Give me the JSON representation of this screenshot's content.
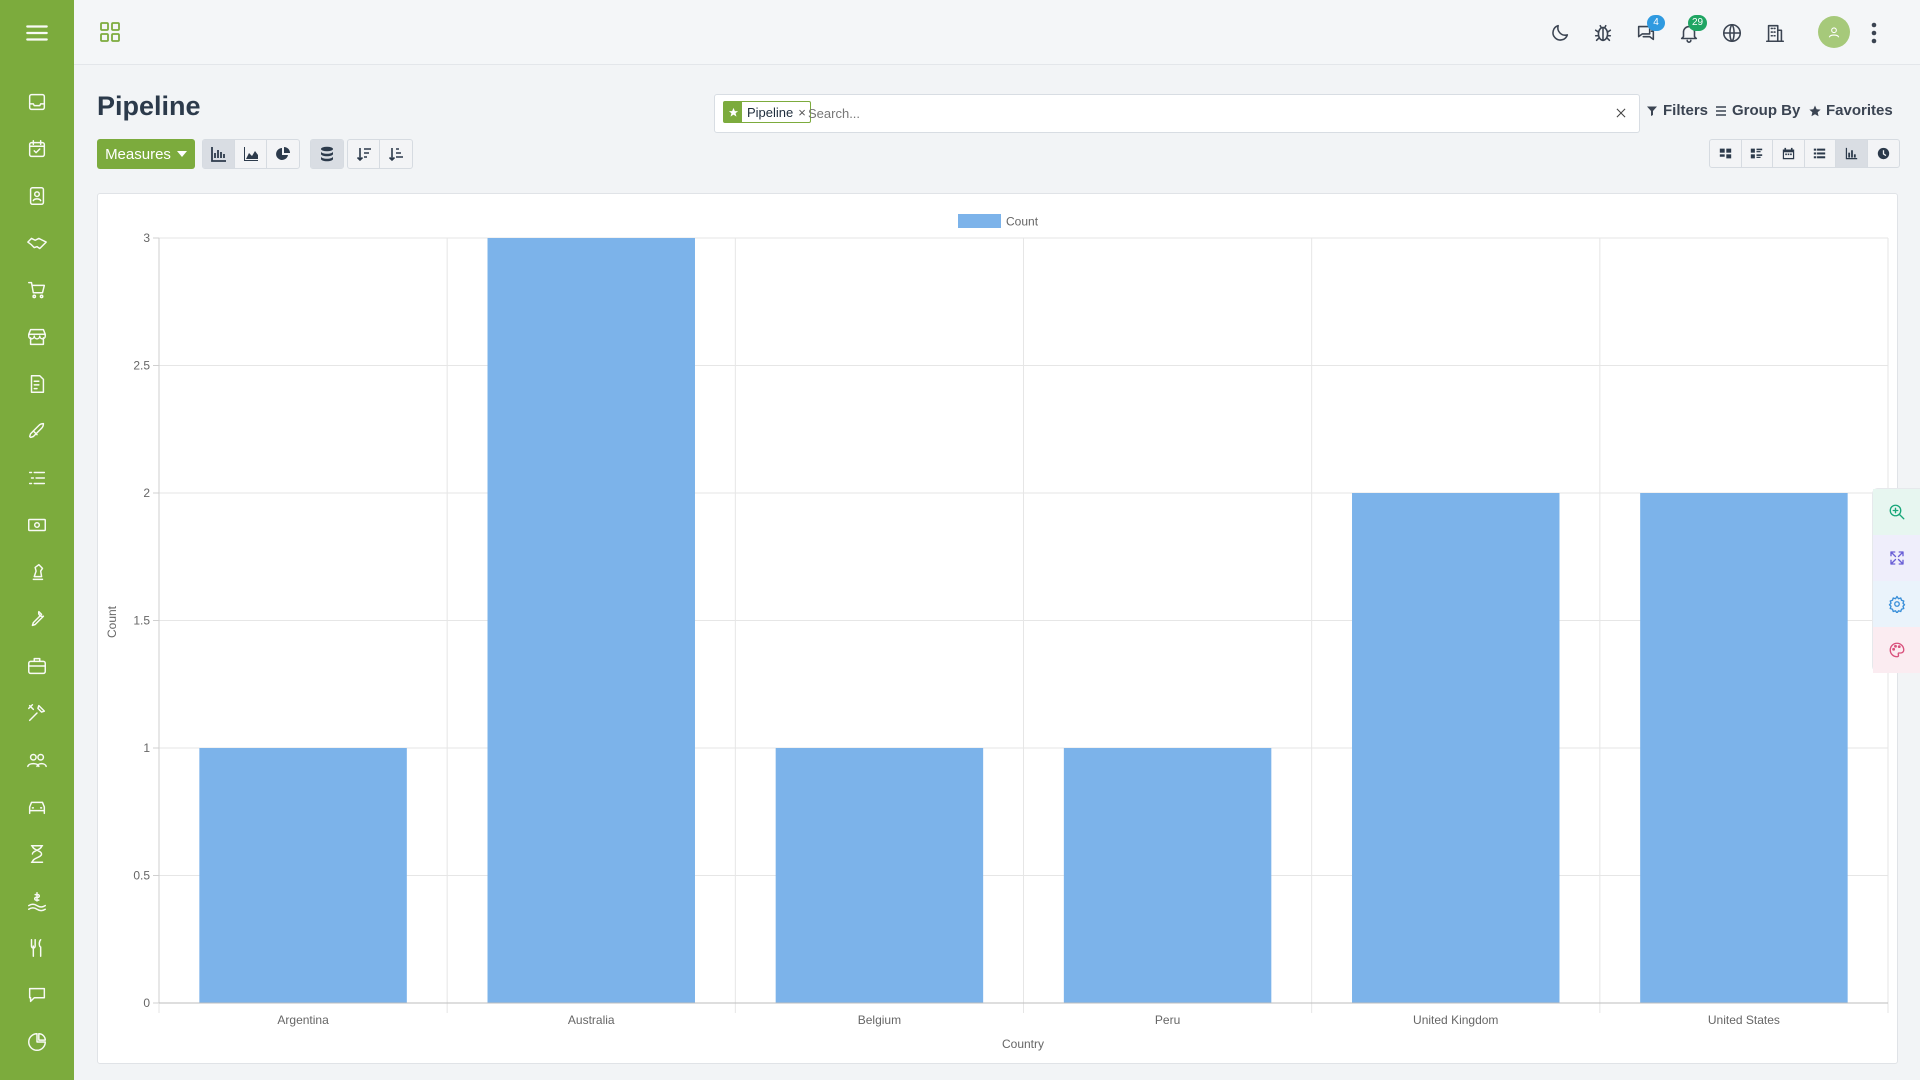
{
  "sidebar": {
    "items": [
      {
        "icon": "menu-icon"
      },
      {
        "icon": "inbox-icon"
      },
      {
        "icon": "calendar-check-icon"
      },
      {
        "icon": "contacts-icon"
      },
      {
        "icon": "handshake-icon"
      },
      {
        "icon": "cart-icon"
      },
      {
        "icon": "store-icon"
      },
      {
        "icon": "invoice-icon"
      },
      {
        "icon": "rocket-icon"
      },
      {
        "icon": "list-icon"
      },
      {
        "icon": "money-icon"
      },
      {
        "icon": "chess-icon"
      },
      {
        "icon": "wrench-icon"
      },
      {
        "icon": "briefcase-icon"
      },
      {
        "icon": "tools-icon"
      },
      {
        "icon": "team-icon"
      },
      {
        "icon": "car-icon"
      },
      {
        "icon": "hourglass-icon"
      },
      {
        "icon": "hand-dollar-icon"
      },
      {
        "icon": "utensils-icon"
      },
      {
        "icon": "chat-icon"
      },
      {
        "icon": "pie-icon"
      }
    ],
    "accent": "#7cab3d"
  },
  "topbar": {
    "chat_badge": "4",
    "notification_badge": "29"
  },
  "page": {
    "title": "Pipeline"
  },
  "search": {
    "facet_label": "Pipeline",
    "facet_close": "×",
    "placeholder": "Search..."
  },
  "search_options": {
    "filters": "Filters",
    "group_by": "Group By",
    "favorites": "Favorites"
  },
  "toolbar": {
    "measures_label": "Measures"
  },
  "chart_data": {
    "type": "bar",
    "categories": [
      "Argentina",
      "Australia",
      "Belgium",
      "Peru",
      "United Kingdom",
      "United States"
    ],
    "series": [
      {
        "name": "Count",
        "values": [
          1,
          3,
          1,
          1,
          2,
          2
        ],
        "color": "#7cb3ea"
      }
    ],
    "xlabel": "Country",
    "ylabel": "Count",
    "ylim": [
      0,
      3
    ],
    "yticks": [
      0,
      0.5,
      1,
      1.5,
      2,
      2.5,
      3
    ],
    "grid": true,
    "legend_position": "top-center"
  }
}
